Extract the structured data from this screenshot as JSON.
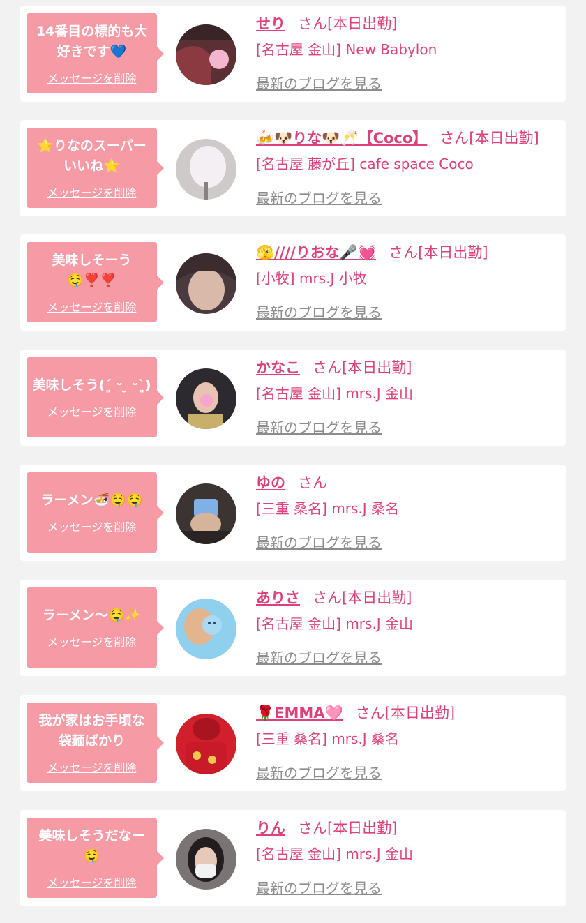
{
  "items": [
    {
      "message": "14番目の標的も大\n好きです💙",
      "delete_label": "メッセージを削除",
      "name": "せり",
      "status": "さん[本日出勤]",
      "shop": "[名古屋 金山] New Babylon",
      "blog_link": "最新のブログを見る"
    },
    {
      "message": "⭐りなのスーパー\nいいね⭐",
      "delete_label": "メッセージを削除",
      "name": "🍻🐶りな🐶🥂【Coco】",
      "status": "さん[本日出勤]",
      "shop": "[名古屋 藤が丘] cafe space Coco",
      "blog_link": "最新のブログを見る"
    },
    {
      "message": "美味しそーう\n🤤❣️❣️",
      "delete_label": "メッセージを削除",
      "name": "🫣////りおな🎤💓",
      "status": "さん[本日出勤]",
      "shop": "[小牧] mrs.J 小牧",
      "blog_link": "最新のブログを見る"
    },
    {
      "message": "美味しそう(´͈ ᵕ ̮ ᵕ`͈)",
      "delete_label": "メッセージを削除",
      "name": "かなこ",
      "status": "さん[本日出勤]",
      "shop": "[名古屋 金山] mrs.J 金山",
      "blog_link": "最新のブログを見る"
    },
    {
      "message": "ラーメン🍜🤤🤤",
      "delete_label": "メッセージを削除",
      "name": "ゆの",
      "status": "さん",
      "shop": "[三重 桑名] mrs.J 桑名",
      "blog_link": "最新のブログを見る"
    },
    {
      "message": "ラーメン〜🤤✨",
      "delete_label": "メッセージを削除",
      "name": "ありさ",
      "status": "さん[本日出勤]",
      "shop": "[名古屋 金山] mrs.J 金山",
      "blog_link": "最新のブログを見る"
    },
    {
      "message": "我が家はお手頃な\n袋麺ばかり",
      "delete_label": "メッセージを削除",
      "name": "🌹EMMA🩷",
      "status": "さん[本日出勤]",
      "shop": "[三重 桑名] mrs.J 桑名",
      "blog_link": "最新のブログを見る"
    },
    {
      "message": "美味しそうだなー\n🤤",
      "delete_label": "メッセージを削除",
      "name": "りん",
      "status": "さん[本日出勤]",
      "shop": "[名古屋 金山] mrs.J 金山",
      "blog_link": "最新のブログを見る"
    }
  ],
  "colors": {
    "bubble": "#f69aa5",
    "accent": "#e0407a",
    "link_gray": "#8c8c8c",
    "page_bg": "#f2f2f2"
  },
  "icons": {
    "avatar": "profile-photo-icon"
  }
}
